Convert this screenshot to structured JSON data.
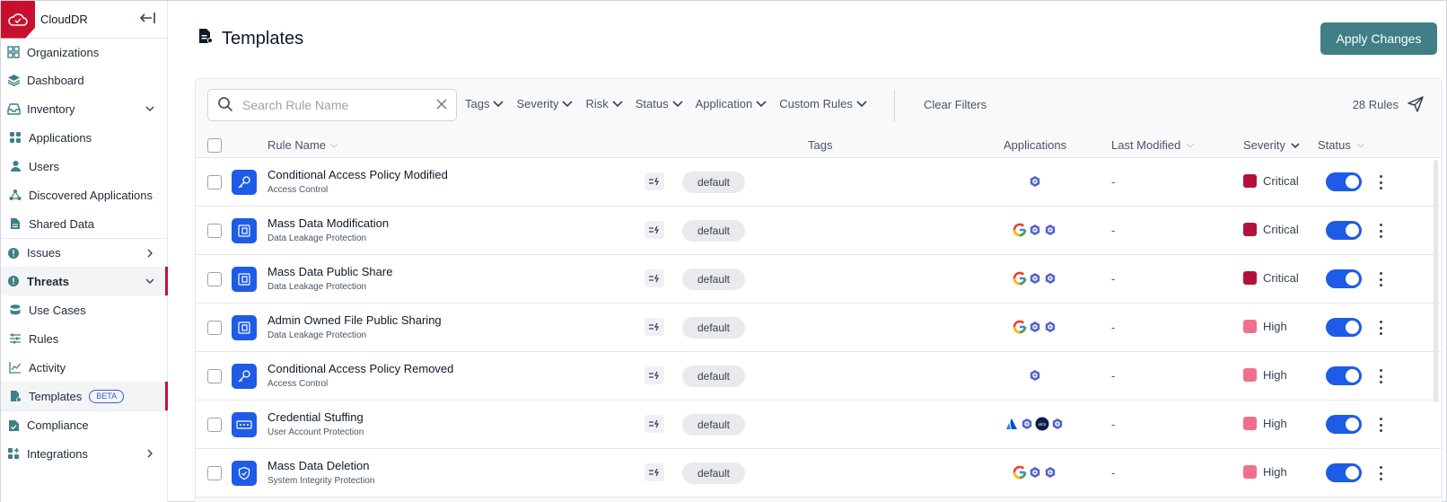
{
  "app": {
    "name": "CloudDR"
  },
  "sidebar": {
    "items": [
      {
        "label": "Organizations",
        "icon": "grid-icon"
      },
      {
        "label": "Dashboard",
        "icon": "layers-icon"
      },
      {
        "label": "Inventory",
        "icon": "inbox-icon",
        "chevron": "down"
      },
      {
        "label": "Applications",
        "icon": "apps-icon"
      },
      {
        "label": "Users",
        "icon": "user-icon"
      },
      {
        "label": "Discovered Applications",
        "icon": "share-icon"
      },
      {
        "label": "Shared Data",
        "icon": "file-icon"
      },
      {
        "label": "Issues",
        "icon": "alert-icon",
        "chevron": "right"
      },
      {
        "label": "Threats",
        "icon": "alert-icon",
        "chevron": "down",
        "active": true
      },
      {
        "label": "Use Cases",
        "icon": "stack-icon"
      },
      {
        "label": "Rules",
        "icon": "sliders-icon"
      },
      {
        "label": "Activity",
        "icon": "chart-icon"
      },
      {
        "label": "Templates",
        "icon": "template-icon",
        "badge": "BETA",
        "active": true
      },
      {
        "label": "Compliance",
        "icon": "compliance-icon"
      },
      {
        "label": "Integrations",
        "icon": "integrations-icon",
        "chevron": "right"
      }
    ]
  },
  "header": {
    "title": "Templates",
    "apply_label": "Apply Changes"
  },
  "search": {
    "placeholder": "Search Rule Name"
  },
  "filters": [
    "Tags",
    "Severity",
    "Risk",
    "Status",
    "Application",
    "Custom Rules"
  ],
  "clear_filters": "Clear Filters",
  "rules_count": "28 Rules",
  "table": {
    "columns": {
      "rule_name": "Rule Name",
      "tags": "Tags",
      "applications": "Applications",
      "last_modified": "Last Modified",
      "severity": "Severity",
      "status": "Status"
    },
    "rows": [
      {
        "name": "Conditional Access Policy Modified",
        "category": "Access Control",
        "icon": "key-icon",
        "tag": "default",
        "apps": [
          "ms-icon"
        ],
        "modified": "-",
        "severity": "Critical",
        "enabled": true
      },
      {
        "name": "Mass Data Modification",
        "category": "Data Leakage Protection",
        "icon": "folder-icon",
        "tag": "default",
        "apps": [
          "google-icon",
          "ms-icon",
          "ms-icon"
        ],
        "modified": "-",
        "severity": "Critical",
        "enabled": true
      },
      {
        "name": "Mass Data Public Share",
        "category": "Data Leakage Protection",
        "icon": "folder-icon",
        "tag": "default",
        "apps": [
          "google-icon",
          "ms-icon",
          "ms-icon"
        ],
        "modified": "-",
        "severity": "Critical",
        "enabled": true
      },
      {
        "name": "Admin Owned File Public Sharing",
        "category": "Data Leakage Protection",
        "icon": "folder-icon",
        "tag": "default",
        "apps": [
          "google-icon",
          "ms-icon",
          "ms-icon"
        ],
        "modified": "-",
        "severity": "High",
        "enabled": true
      },
      {
        "name": "Conditional Access Policy Removed",
        "category": "Access Control",
        "icon": "key-icon",
        "tag": "default",
        "apps": [
          "ms-icon"
        ],
        "modified": "-",
        "severity": "High",
        "enabled": true
      },
      {
        "name": "Credential Stuffing",
        "category": "User Account Protection",
        "icon": "password-icon",
        "tag": "default",
        "apps": [
          "atlassian-icon",
          "ms-icon",
          "okta-icon",
          "ms-icon"
        ],
        "modified": "-",
        "severity": "High",
        "enabled": true
      },
      {
        "name": "Mass Data Deletion",
        "category": "System Integrity Protection",
        "icon": "shield-icon",
        "tag": "default",
        "apps": [
          "google-icon",
          "ms-icon",
          "ms-icon"
        ],
        "modified": "-",
        "severity": "High",
        "enabled": true
      }
    ]
  },
  "colors": {
    "accent": "#c8102e",
    "primary": "#1e5be6",
    "apply": "#3f7f85",
    "critical": "#b3123a",
    "high": "#f0708a"
  }
}
